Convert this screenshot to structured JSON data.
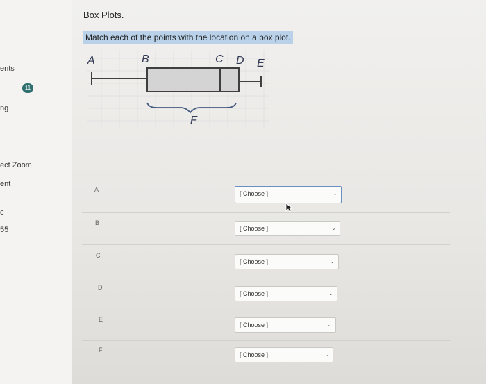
{
  "sidebar": {
    "items": [
      {
        "label": "ents",
        "top": 0
      },
      {
        "label": "ng"
      },
      {
        "label": "ect Zoom"
      },
      {
        "label": "ent"
      },
      {
        "label": "c"
      },
      {
        "label": "55"
      }
    ],
    "badge": "11"
  },
  "question": {
    "title": "Box Plots.",
    "prompt": "Match each of the points with the location on a box plot.",
    "figure_labels": {
      "a": "A",
      "b": "B",
      "c": "C",
      "d": "D",
      "e": "E",
      "f": "F"
    }
  },
  "rows": [
    {
      "label": "A",
      "select": "[ Choose ]"
    },
    {
      "label": "B",
      "select": "[ Choose ]"
    },
    {
      "label": "C",
      "select": "[ Choose ]"
    },
    {
      "label": "D",
      "select": "[ Choose ]"
    },
    {
      "label": "E",
      "select": "[ Choose ]"
    },
    {
      "label": "F",
      "select": "[ Choose ]"
    }
  ],
  "colors": {
    "prompt_highlight": "#b9d2ea",
    "box_fill": "#d4d4d4",
    "focus_border": "#6a8fc2"
  }
}
